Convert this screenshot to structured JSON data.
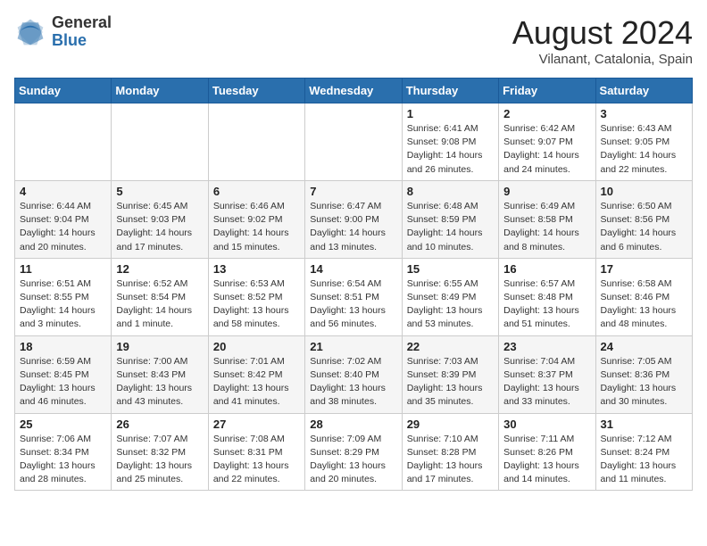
{
  "header": {
    "logo_general": "General",
    "logo_blue": "Blue",
    "month_title": "August 2024",
    "location": "Vilanant, Catalonia, Spain"
  },
  "weekdays": [
    "Sunday",
    "Monday",
    "Tuesday",
    "Wednesday",
    "Thursday",
    "Friday",
    "Saturday"
  ],
  "weeks": [
    [
      {
        "day": "",
        "info": ""
      },
      {
        "day": "",
        "info": ""
      },
      {
        "day": "",
        "info": ""
      },
      {
        "day": "",
        "info": ""
      },
      {
        "day": "1",
        "info": "Sunrise: 6:41 AM\nSunset: 9:08 PM\nDaylight: 14 hours\nand 26 minutes."
      },
      {
        "day": "2",
        "info": "Sunrise: 6:42 AM\nSunset: 9:07 PM\nDaylight: 14 hours\nand 24 minutes."
      },
      {
        "day": "3",
        "info": "Sunrise: 6:43 AM\nSunset: 9:05 PM\nDaylight: 14 hours\nand 22 minutes."
      }
    ],
    [
      {
        "day": "4",
        "info": "Sunrise: 6:44 AM\nSunset: 9:04 PM\nDaylight: 14 hours\nand 20 minutes."
      },
      {
        "day": "5",
        "info": "Sunrise: 6:45 AM\nSunset: 9:03 PM\nDaylight: 14 hours\nand 17 minutes."
      },
      {
        "day": "6",
        "info": "Sunrise: 6:46 AM\nSunset: 9:02 PM\nDaylight: 14 hours\nand 15 minutes."
      },
      {
        "day": "7",
        "info": "Sunrise: 6:47 AM\nSunset: 9:00 PM\nDaylight: 14 hours\nand 13 minutes."
      },
      {
        "day": "8",
        "info": "Sunrise: 6:48 AM\nSunset: 8:59 PM\nDaylight: 14 hours\nand 10 minutes."
      },
      {
        "day": "9",
        "info": "Sunrise: 6:49 AM\nSunset: 8:58 PM\nDaylight: 14 hours\nand 8 minutes."
      },
      {
        "day": "10",
        "info": "Sunrise: 6:50 AM\nSunset: 8:56 PM\nDaylight: 14 hours\nand 6 minutes."
      }
    ],
    [
      {
        "day": "11",
        "info": "Sunrise: 6:51 AM\nSunset: 8:55 PM\nDaylight: 14 hours\nand 3 minutes."
      },
      {
        "day": "12",
        "info": "Sunrise: 6:52 AM\nSunset: 8:54 PM\nDaylight: 14 hours\nand 1 minute."
      },
      {
        "day": "13",
        "info": "Sunrise: 6:53 AM\nSunset: 8:52 PM\nDaylight: 13 hours\nand 58 minutes."
      },
      {
        "day": "14",
        "info": "Sunrise: 6:54 AM\nSunset: 8:51 PM\nDaylight: 13 hours\nand 56 minutes."
      },
      {
        "day": "15",
        "info": "Sunrise: 6:55 AM\nSunset: 8:49 PM\nDaylight: 13 hours\nand 53 minutes."
      },
      {
        "day": "16",
        "info": "Sunrise: 6:57 AM\nSunset: 8:48 PM\nDaylight: 13 hours\nand 51 minutes."
      },
      {
        "day": "17",
        "info": "Sunrise: 6:58 AM\nSunset: 8:46 PM\nDaylight: 13 hours\nand 48 minutes."
      }
    ],
    [
      {
        "day": "18",
        "info": "Sunrise: 6:59 AM\nSunset: 8:45 PM\nDaylight: 13 hours\nand 46 minutes."
      },
      {
        "day": "19",
        "info": "Sunrise: 7:00 AM\nSunset: 8:43 PM\nDaylight: 13 hours\nand 43 minutes."
      },
      {
        "day": "20",
        "info": "Sunrise: 7:01 AM\nSunset: 8:42 PM\nDaylight: 13 hours\nand 41 minutes."
      },
      {
        "day": "21",
        "info": "Sunrise: 7:02 AM\nSunset: 8:40 PM\nDaylight: 13 hours\nand 38 minutes."
      },
      {
        "day": "22",
        "info": "Sunrise: 7:03 AM\nSunset: 8:39 PM\nDaylight: 13 hours\nand 35 minutes."
      },
      {
        "day": "23",
        "info": "Sunrise: 7:04 AM\nSunset: 8:37 PM\nDaylight: 13 hours\nand 33 minutes."
      },
      {
        "day": "24",
        "info": "Sunrise: 7:05 AM\nSunset: 8:36 PM\nDaylight: 13 hours\nand 30 minutes."
      }
    ],
    [
      {
        "day": "25",
        "info": "Sunrise: 7:06 AM\nSunset: 8:34 PM\nDaylight: 13 hours\nand 28 minutes."
      },
      {
        "day": "26",
        "info": "Sunrise: 7:07 AM\nSunset: 8:32 PM\nDaylight: 13 hours\nand 25 minutes."
      },
      {
        "day": "27",
        "info": "Sunrise: 7:08 AM\nSunset: 8:31 PM\nDaylight: 13 hours\nand 22 minutes."
      },
      {
        "day": "28",
        "info": "Sunrise: 7:09 AM\nSunset: 8:29 PM\nDaylight: 13 hours\nand 20 minutes."
      },
      {
        "day": "29",
        "info": "Sunrise: 7:10 AM\nSunset: 8:28 PM\nDaylight: 13 hours\nand 17 minutes."
      },
      {
        "day": "30",
        "info": "Sunrise: 7:11 AM\nSunset: 8:26 PM\nDaylight: 13 hours\nand 14 minutes."
      },
      {
        "day": "31",
        "info": "Sunrise: 7:12 AM\nSunset: 8:24 PM\nDaylight: 13 hours\nand 11 minutes."
      }
    ]
  ]
}
